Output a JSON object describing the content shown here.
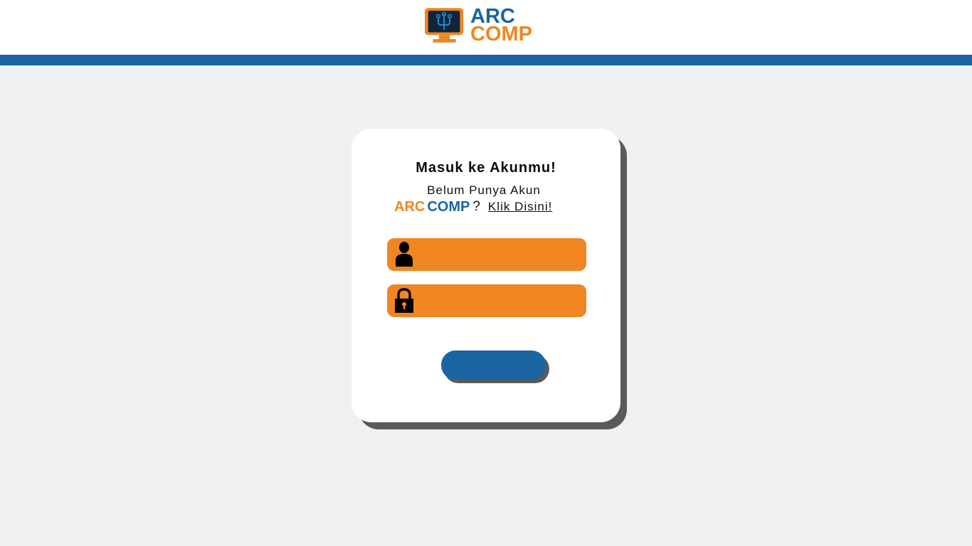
{
  "colors": {
    "blue": "#1b64a2",
    "orange": "#ef8622",
    "background": "#eff0f2"
  },
  "header": {
    "logo_word_1": "ARC",
    "logo_word_2": "COMP",
    "logo_icon": "monitor-circuit-icon"
  },
  "login_card": {
    "title": "Masuk ke Akunmu!",
    "subtitle": "Belum Punya Akun",
    "brand_arc": "ARC",
    "brand_comp": "COMP",
    "question_mark": "?",
    "signup_link": "Klik Disini!",
    "username_field": {
      "icon": "user-icon",
      "value": "",
      "placeholder": ""
    },
    "password_field": {
      "icon": "lock-icon",
      "value": "",
      "placeholder": ""
    },
    "submit_label": ""
  }
}
